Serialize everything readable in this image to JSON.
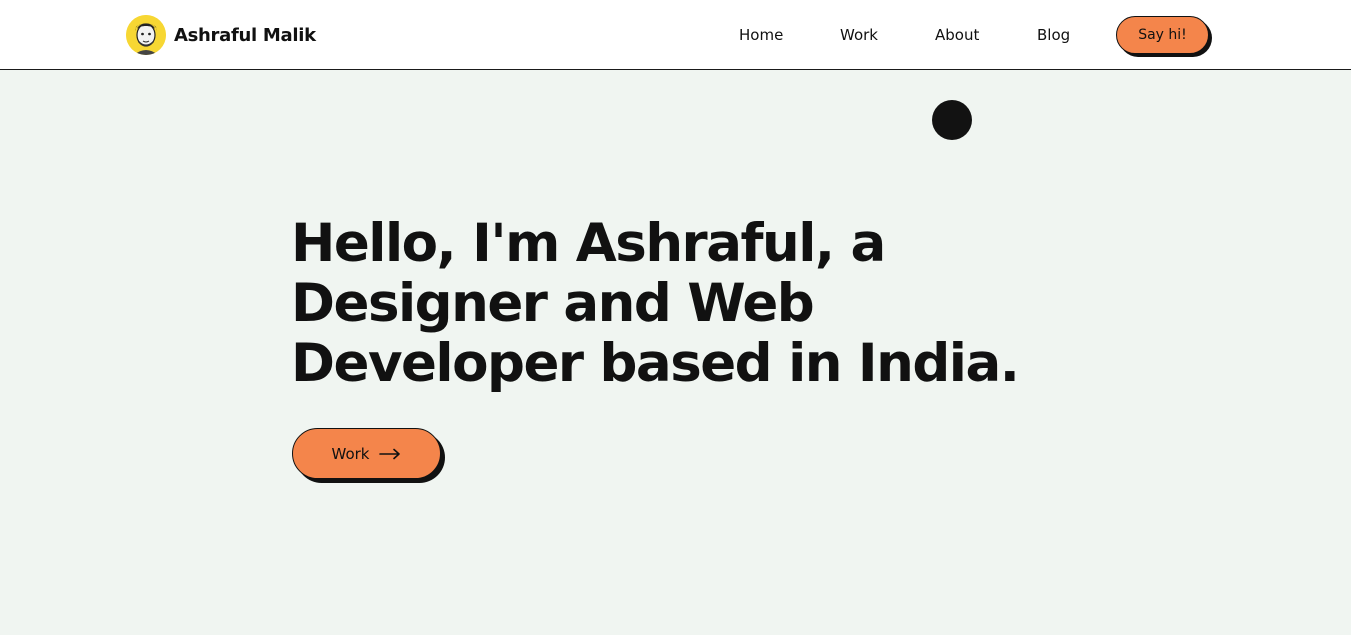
{
  "brand": {
    "name": "Ashraful Malik",
    "avatar_icon": "avatar-portrait-icon"
  },
  "nav": {
    "items": [
      {
        "label": "Home"
      },
      {
        "label": "Work"
      },
      {
        "label": "About"
      },
      {
        "label": "Blog"
      }
    ],
    "cta_label": "Say hi!"
  },
  "hero": {
    "headline": "Hello, I'm Ashraful, a Designer and Web Developer based in India.",
    "cta_label": "Work",
    "cta_icon": "arrow-right-icon"
  },
  "colors": {
    "background": "#f0f5f1",
    "accent": "#f4854b",
    "text": "#111111",
    "avatar_bg": "#f7d733"
  }
}
